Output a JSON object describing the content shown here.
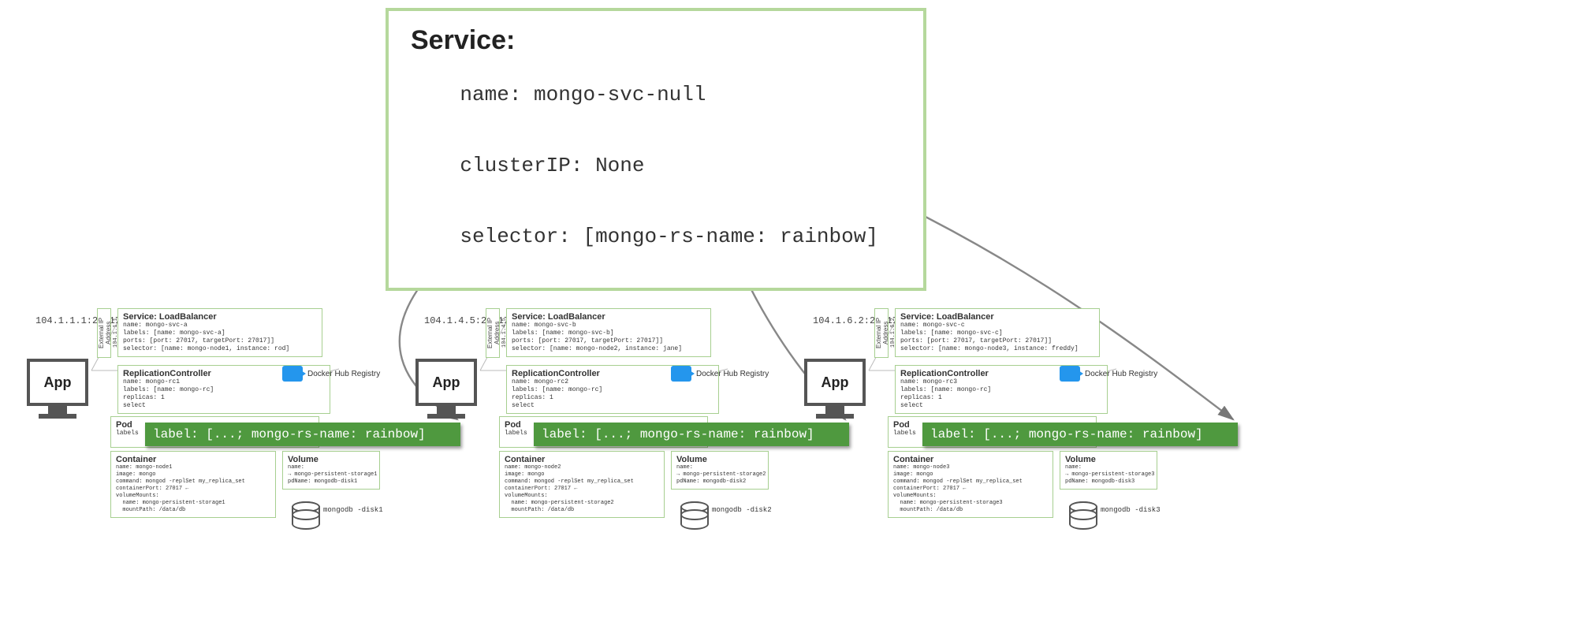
{
  "service": {
    "title": "Service:",
    "name_key": "name:",
    "name_val": "mongo-svc-null",
    "cip_key": "clusterIP:",
    "cip_val": "None",
    "sel_key": "selector:",
    "sel_val": "[mongo-rs-name: rainbow]"
  },
  "app_label": "App",
  "ext_ip_label": "External IP\nAddress",
  "dhr_label": "Docker Hub Registry",
  "pod_heading": "Pod",
  "pod_labels_key": "labels",
  "container_heading": "Container",
  "volume_heading": "Volume",
  "label_highlight": "label: [...; mongo-rs-name: rainbow]",
  "clusters": [
    {
      "ip": "104.1.1.1:27017",
      "ext_ip": "104.1.1.1",
      "lb": {
        "title": "Service: LoadBalancer",
        "name": "name: mongo-svc-a",
        "labels": "labels: [name: mongo-svc-a]",
        "ports": "ports: [port: 27017, targetPort: 27017]]",
        "selector": "selector: [name: mongo-node1, instance: rod]"
      },
      "rc": {
        "title": "ReplicationController",
        "name": "name: mongo-rc1",
        "labels": "labels: [name: mongo-rc]",
        "replicas": "replicas: 1",
        "select": "select"
      },
      "container": "name: mongo-node1\nimage: mongo\ncommand: mongod -replSet my_replica_set\ncontainerPort: 27017 ←\nvolumeMounts:\n  name: mongo-persistent-storage1\n  mountPath: /data/db",
      "volume": "name:\n→ mongo-persistent-storage1\npdName: mongodb-disk1",
      "disk": "mongodb\n-disk1"
    },
    {
      "ip": "104.1.4.5:27017",
      "ext_ip": "104.1.4.5",
      "lb": {
        "title": "Service: LoadBalancer",
        "name": "name: mongo-svc-b",
        "labels": "labels: [name: mongo-svc-b]",
        "ports": "ports: [port: 27017, targetPort: 27017]]",
        "selector": "selector: [name: mongo-node2, instance: jane]"
      },
      "rc": {
        "title": "ReplicationController",
        "name": "name: mongo-rc2",
        "labels": "labels: [name: mongo-rc]",
        "replicas": "replicas: 1",
        "select": "select"
      },
      "container": "name: mongo-node2\nimage: mongo\ncommand: mongod -replSet my_replica_set\ncontainerPort: 27017 ←\nvolumeMounts:\n  name: mongo-persistent-storage2\n  mountPath: /data/db",
      "volume": "name:\n→ mongo-persistent-storage2\npdName: mongodb-disk2",
      "disk": "mongodb\n-disk2"
    },
    {
      "ip": "104.1.6.2:27017",
      "ext_ip": "104.1.6.2",
      "lb": {
        "title": "Service: LoadBalancer",
        "name": "name: mongo-svc-c",
        "labels": "labels: [name: mongo-svc-c]",
        "ports": "ports: [port: 27017, targetPort: 27017]]",
        "selector": "selector: [name: mongo-node3, instance: freddy]"
      },
      "rc": {
        "title": "ReplicationController",
        "name": "name: mongo-rc3",
        "labels": "labels: [name: mongo-rc]",
        "replicas": "replicas: 1",
        "select": "select"
      },
      "container": "name: mongo-node3\nimage: mongo\ncommand: mongod -replSet my_replica_set\ncontainerPort: 27017 ←\nvolumeMounts:\n  name: mongo-persistent-storage3\n  mountPath: /data/db",
      "volume": "name:\n→ mongo-persistent-storage3\npdName: mongodb-disk3",
      "disk": "mongodb\n-disk3"
    }
  ]
}
